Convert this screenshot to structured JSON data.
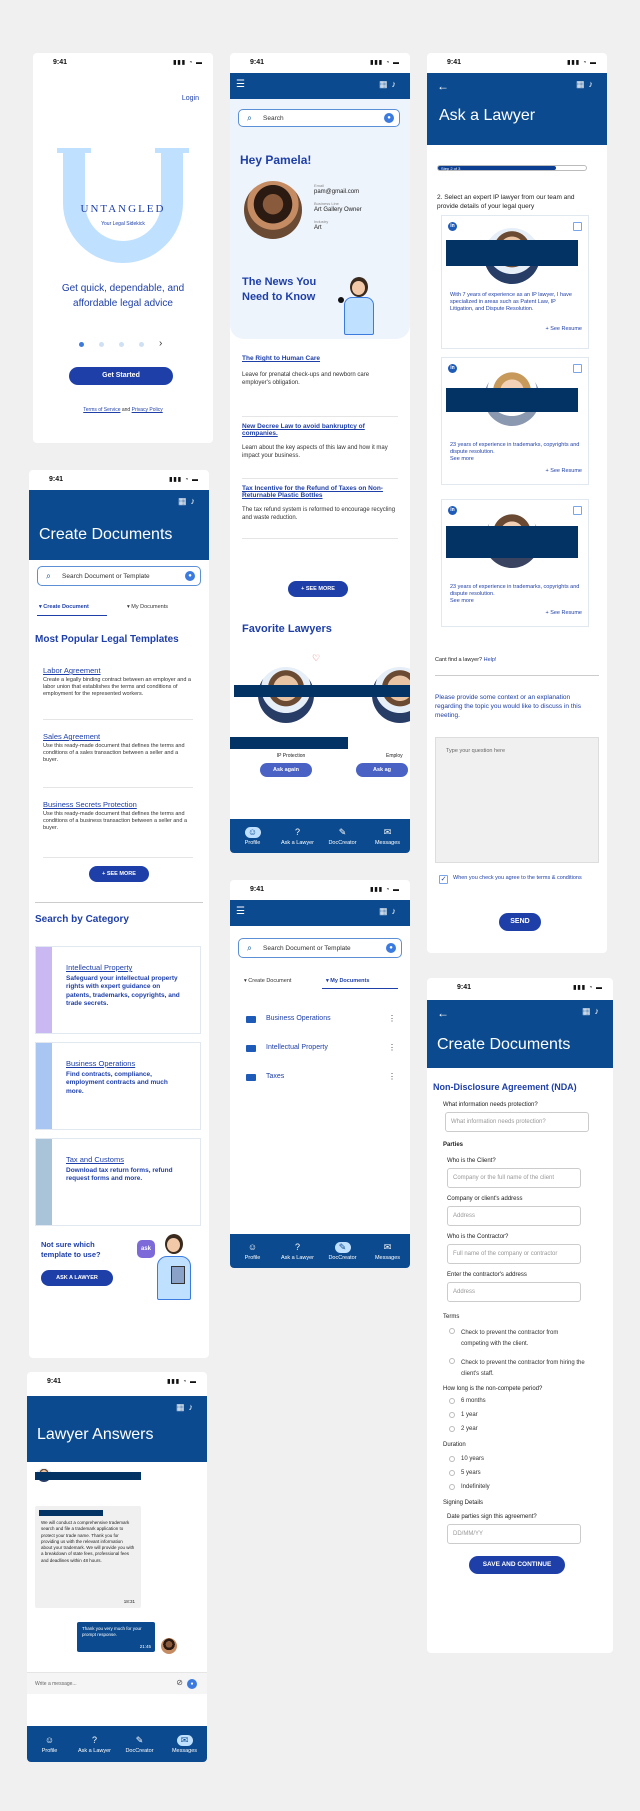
{
  "status": {
    "time": "9:41"
  },
  "onboarding": {
    "login": "Login",
    "brand": "UNTANGLED",
    "brand_sub": "Your Legal Sidekick",
    "tagline": "Get quick, dependable, and affordable legal advice",
    "cta": "Get Started",
    "legal_a": "Terms of Service",
    "legal_and": "and",
    "legal_b": "Privacy Policy",
    "next": "›"
  },
  "home": {
    "search": "Search",
    "greeting": "Hey Pamela!",
    "email_label": "Email",
    "email": "pam@gmail.com",
    "business_label": "Business Line",
    "business": "Art Gallery Owner",
    "industry_label": "Industry",
    "industry": "Art",
    "news_title": "The News You Need to Know",
    "news": [
      {
        "title": "The Right to Human Care",
        "body": "Leave for prenatal check-ups and newborn care employer's obligation."
      },
      {
        "title": "New Decree Law to avoid bankruptcy of companies.",
        "body": "Learn about the key aspects of this law and how it may impact your business."
      },
      {
        "title": "Tax Incentive for the Refund of Taxes on Non-Returnable Plastic Bottles",
        "body": "The tax refund system is reformed to encourage recycling and waste reduction."
      }
    ],
    "see_more": "+ SEE MORE",
    "fav_title": "Favorite Lawyers",
    "fav1_spec": "IP Protection",
    "fav2_spec": "Employ",
    "ask_again": "Ask again",
    "ask_again2": "Ask ag"
  },
  "tabs": {
    "profile": "Profile",
    "ask": "Ask a Lawyer",
    "doc": "DocCreator",
    "messages": "Messages"
  },
  "ask": {
    "title": "Ask a Lawyer",
    "step": "Step 2 of 3",
    "instruction": "2. Select an expert IP lawyer from our team and provide details of your legal query",
    "lawyers": [
      {
        "desc": "With 7 years of experience as an IP lawyer, I have specialized in areas such as Patent Law, IP Litigation, and Dispute Resolution.",
        "resume": "+ See Resume"
      },
      {
        "desc": "23 years of experience in trademarks, copyrights and dispute resolution.",
        "more": "See more",
        "resume": "+ See Resume"
      },
      {
        "desc": "23 years of experience in trademarks, copyrights and dispute resolution.",
        "more": "See more",
        "resume": "+ See Resume"
      }
    ],
    "cant_find": "Cant find a lawyer?",
    "help": "Help!",
    "context": "Please provide some context or an explanation regarding the topic you would like to discuss in this meeting.",
    "question_placeholder": "Type your question here",
    "agree": "When you check you agree to the terms & conditions",
    "send": "SEND"
  },
  "createDocs": {
    "title": "Create Documents",
    "search": "Search Document or Template",
    "tab_create": "Create Document",
    "tab_my": "My Documents",
    "popular": "Most Popular Legal Templates",
    "templates": [
      {
        "name": "Labor Agreement",
        "desc": "Create a legally binding contract between an employer and a labor union that establishes the terms and conditions of employment for the represented workers."
      },
      {
        "name": "Sales Agreement",
        "desc": "Use this ready-made document that defines the terms and conditions of a sales transaction between a seller and a buyer."
      },
      {
        "name": "Business Secrets Protection",
        "desc": "Use this ready-made document that defines the terms and conditions of a business transaction between a seller and a buyer."
      }
    ],
    "see_more": "+ SEE MORE",
    "by_category": "Search by Category",
    "categories": [
      {
        "name": "Intellectual Property",
        "desc": "Safeguard your intellectual property rights with expert guidance on patents, trademarks, copyrights, and trade secrets.",
        "color": "#c9b8f2"
      },
      {
        "name": "Business Operations",
        "desc": "Find contracts, compliance, employment contracts and much more.",
        "color": "#a9c6f2"
      },
      {
        "name": "Tax and Customs",
        "desc": "Download tax return forms, refund request forms and more.",
        "color": "#a9c3d8"
      }
    ],
    "not_sure": "Not sure which template to use?",
    "ask_btn": "ASK A LAWYER"
  },
  "myDocs": {
    "search": "Search Document or Template",
    "tab_create": "Create Document",
    "tab_my": "My Documents",
    "folders": [
      "Business Operations",
      "Intellectual Property",
      "Taxes"
    ]
  },
  "nda": {
    "title": "Create Documents",
    "heading": "Non-Disclosure Agreement (NDA)",
    "q_info": "What information needs protection?",
    "ph_info": "What information needs protection?",
    "parties": "Parties",
    "q_client": "Who is the Client?",
    "ph_client": "Company or the full name of the client",
    "q_client_addr": "Company or client's address",
    "ph_addr": "Address",
    "q_contractor": "Who is the Contractor?",
    "ph_contractor": "Full name of the company or contractor",
    "q_contractor_addr": "Enter the contractor's address",
    "ph_addr2": "Address",
    "terms": "Terms",
    "term1": "Check to prevent the contractor from competing with the client.",
    "term2": "Check to prevent the contractor from hiring the client's staff.",
    "q_period": "How long is the non-compete period?",
    "periods": [
      "6 months",
      "1 year",
      "2 year"
    ],
    "duration": "Duration",
    "durations": [
      "10 years",
      "5 years",
      "Indefinitely"
    ],
    "signing": "Signing Details",
    "q_date": "Date parties sign this agreement?",
    "ph_date": "DD/MM/YY",
    "save": "SAVE AND CONTINUE"
  },
  "answers": {
    "title": "Lawyer Answers",
    "msg": "We will conduct a comprehensive trademark search and file a trademark application to protect your trade name. Thank you for providing us with the relevant information about your trademark. We will provide you with a breakdown of state fees, professional fees and deadlines within 48 hours.",
    "msg_time": "18:31",
    "reply": "Thank you very much for your prompt response.",
    "reply_time": "21:45",
    "placeholder": "Write a message..."
  },
  "colors": {
    "primary": "#0b4a8f",
    "accent": "#1e3fa8",
    "light": "#bfe0ff"
  }
}
